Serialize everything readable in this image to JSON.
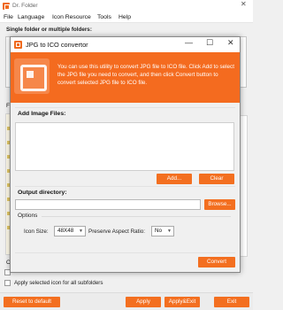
{
  "main_window": {
    "title": "Dr. Folder",
    "menu": [
      "File",
      "Language",
      "Icon Resource",
      "Tools",
      "Help"
    ],
    "folders_label": "Single folder or multiple folders:",
    "side_label_f": "F",
    "side_label_o": "O",
    "apply_subfolders_label": "Apply selected icon for all subfolders",
    "reset_button": "Reset to default",
    "apply_button": "Apply",
    "apply_exit_button": "Apply&Exit",
    "exit_button": "Exit"
  },
  "dialog": {
    "title": "JPG to ICO convertor",
    "banner_text": "You can use this utility to convert JPG file to ICO file. Click Add to select the JPG file you need to convert, and then click Convert button to convert selected JPG file to ICO file.",
    "add_image_files_label": "Add Image Files:",
    "add_button": "Add...",
    "clear_button": "Clear",
    "output_directory_label": "Output directory:",
    "output_directory_value": "",
    "browse_button": "Browse...",
    "options_label": "Options",
    "icon_size_label": "Icon Size:",
    "icon_size_value": "48X48",
    "preserve_label": "Preserve Aspect Ratio:",
    "preserve_value": "No",
    "convert_button": "Convert"
  },
  "colors": {
    "accent": "#f36f20",
    "banner": "#f46b1f"
  }
}
